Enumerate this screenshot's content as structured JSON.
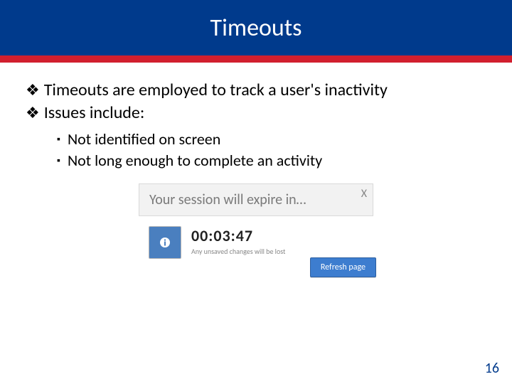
{
  "colors": {
    "title_bg": "#003a8c",
    "title_underbar": "#d11f2e",
    "refresh_btn": "#3d7dcf",
    "info_box": "#4a7fbf"
  },
  "title": "Timeouts",
  "bullets": [
    "Timeouts are employed to track a user's inactivity",
    "Issues include:"
  ],
  "sub_bullets": [
    "Not identified on screen",
    "Not long enough to complete an activity"
  ],
  "dialog": {
    "header": "Your session will expire in…",
    "close_glyph": "X",
    "time": "00:03:47",
    "subtext": "Any unsaved changes will be lost",
    "refresh_label": "Refresh page"
  },
  "page_number": "16"
}
